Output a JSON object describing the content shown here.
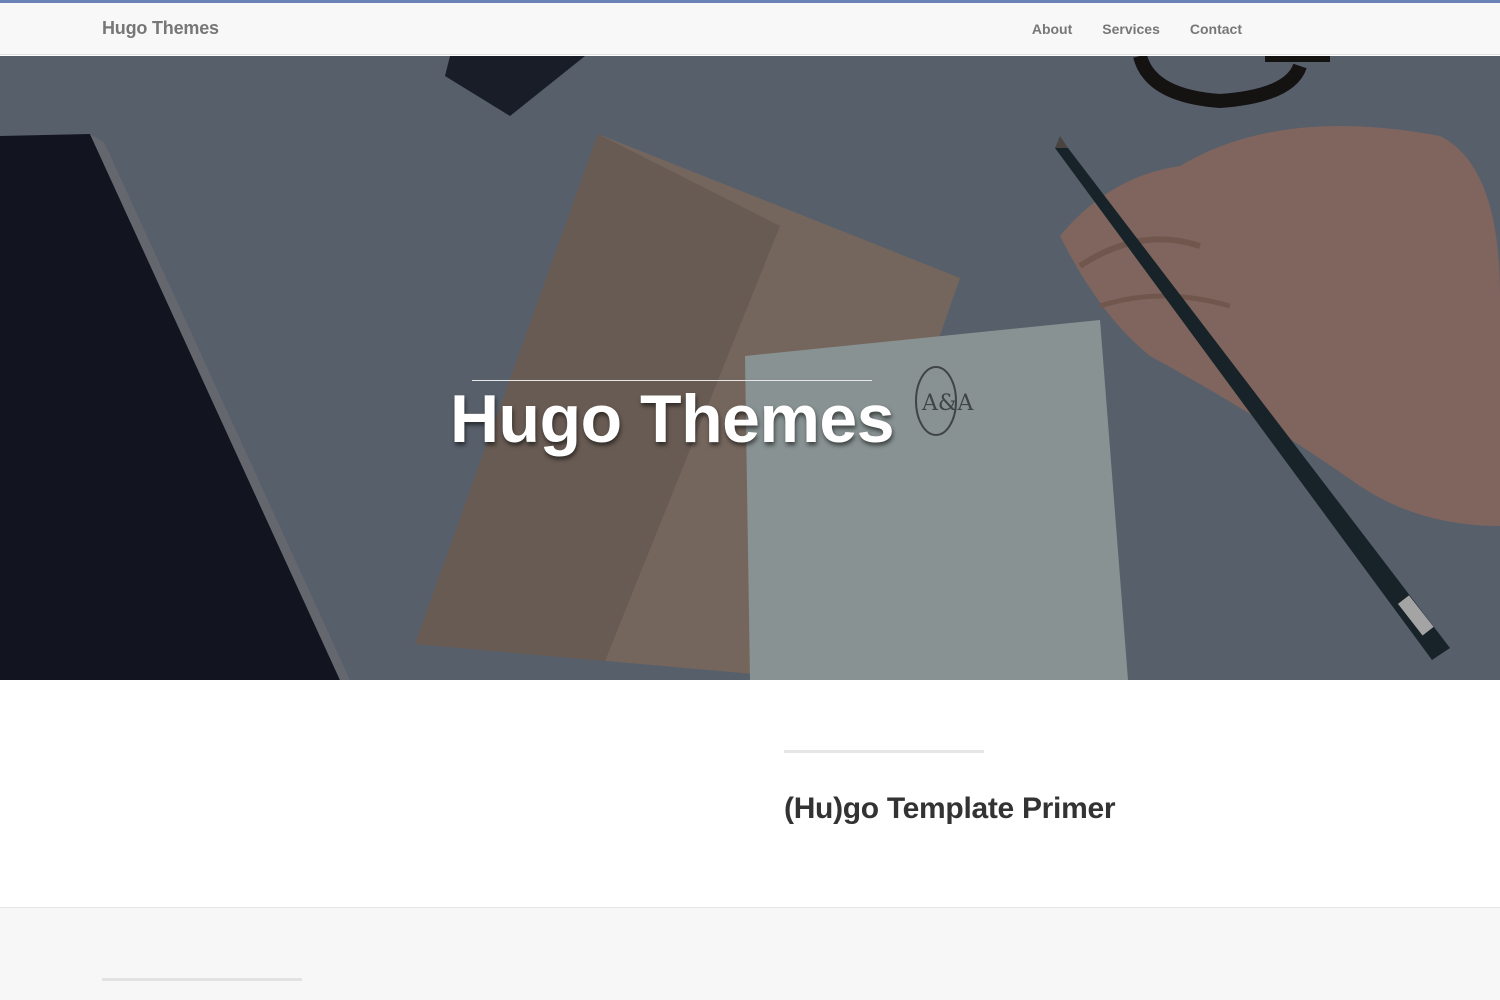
{
  "navbar": {
    "brand": "Hugo Themes",
    "links": [
      "About",
      "Services",
      "Contact"
    ]
  },
  "hero": {
    "title": "Hugo Themes"
  },
  "main": {
    "post_title": "(Hu)go Template Primer"
  },
  "colors": {
    "accent": "#6c83b8",
    "navbar_bg": "#f8f8f8",
    "nav_text": "#777777",
    "heading_text": "#333333"
  }
}
